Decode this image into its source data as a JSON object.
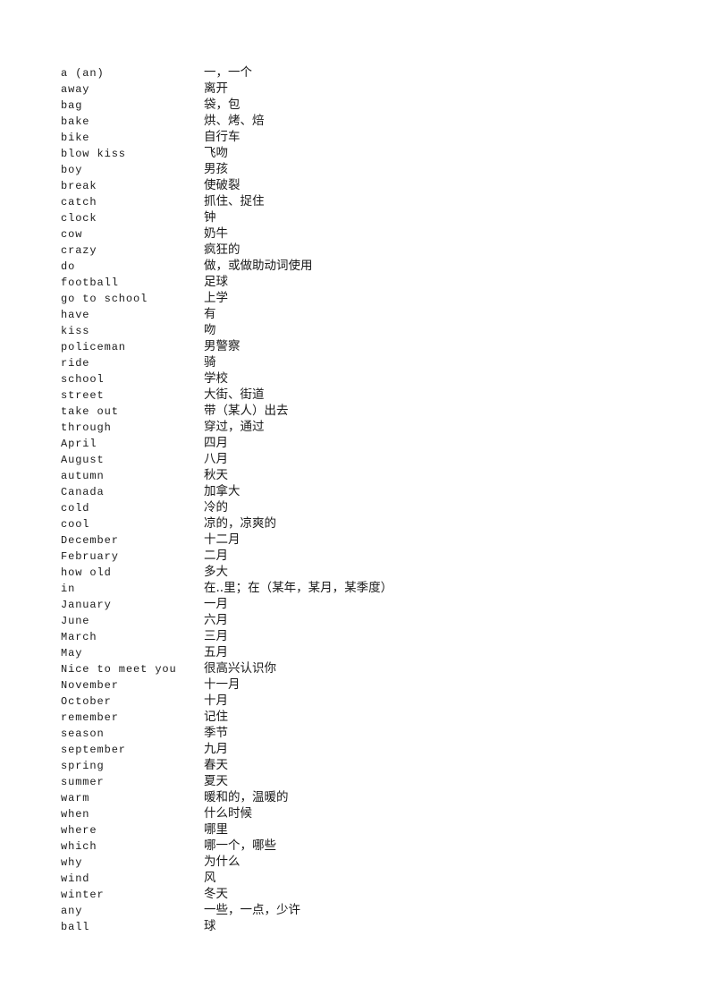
{
  "document": {
    "type": "vocabulary-glossary",
    "columns": {
      "term_header": "",
      "gloss_header": ""
    },
    "entries": [
      {
        "term": "a (an)",
        "gloss": "一，一个"
      },
      {
        "term": "away",
        "gloss": "离开"
      },
      {
        "term": "bag",
        "gloss": "袋，包"
      },
      {
        "term": "bake",
        "gloss": "烘、烤、焙"
      },
      {
        "term": "bike",
        "gloss": "自行车"
      },
      {
        "term": "blow kiss",
        "gloss": "飞吻"
      },
      {
        "term": "boy",
        "gloss": "男孩"
      },
      {
        "term": "break",
        "gloss": "使破裂"
      },
      {
        "term": "catch",
        "gloss": "抓住、捉住"
      },
      {
        "term": "clock",
        "gloss": "钟"
      },
      {
        "term": "cow",
        "gloss": "奶牛"
      },
      {
        "term": "crazy",
        "gloss": "疯狂的"
      },
      {
        "term": "do",
        "gloss": "做，或做助动词使用"
      },
      {
        "term": "football",
        "gloss": "足球"
      },
      {
        "term": "go to school",
        "gloss": "上学"
      },
      {
        "term": "have",
        "gloss": "有"
      },
      {
        "term": "kiss",
        "gloss": "吻"
      },
      {
        "term": "policeman",
        "gloss": "男警察"
      },
      {
        "term": "ride",
        "gloss": "骑"
      },
      {
        "term": "school",
        "gloss": "学校"
      },
      {
        "term": "street",
        "gloss": "大街、街道"
      },
      {
        "term": "take out",
        "gloss": "带（某人）出去"
      },
      {
        "term": "through",
        "gloss": "穿过，通过"
      },
      {
        "term": "April",
        "gloss": "四月"
      },
      {
        "term": "August",
        "gloss": "八月"
      },
      {
        "term": "autumn",
        "gloss": "秋天"
      },
      {
        "term": "Canada",
        "gloss": "加拿大"
      },
      {
        "term": "cold",
        "gloss": "冷的"
      },
      {
        "term": "cool",
        "gloss": "凉的，凉爽的"
      },
      {
        "term": "December",
        "gloss": "十二月"
      },
      {
        "term": "February",
        "gloss": "二月"
      },
      {
        "term": "how old",
        "gloss": "多大"
      },
      {
        "term": "in",
        "gloss": "在..里；在（某年，某月，某季度）"
      },
      {
        "term": "January",
        "gloss": "一月"
      },
      {
        "term": "June",
        "gloss": "六月"
      },
      {
        "term": "March",
        "gloss": "三月"
      },
      {
        "term": "May",
        "gloss": "五月"
      },
      {
        "term": "Nice to meet you",
        "gloss": "很高兴认识你"
      },
      {
        "term": "November",
        "gloss": "十一月"
      },
      {
        "term": "October",
        "gloss": "十月"
      },
      {
        "term": "remember",
        "gloss": "记住"
      },
      {
        "term": "season",
        "gloss": "季节"
      },
      {
        "term": "september",
        "gloss": "九月"
      },
      {
        "term": "spring",
        "gloss": "春天"
      },
      {
        "term": "summer",
        "gloss": "夏天"
      },
      {
        "term": "warm",
        "gloss": "暖和的，温暖的"
      },
      {
        "term": "when",
        "gloss": "什么时候"
      },
      {
        "term": "where",
        "gloss": "哪里"
      },
      {
        "term": "which",
        "gloss": "哪一个，哪些"
      },
      {
        "term": "why",
        "gloss": "为什么"
      },
      {
        "term": "wind",
        "gloss": "风"
      },
      {
        "term": "winter",
        "gloss": "冬天"
      },
      {
        "term": "any",
        "gloss": "一些，一点，少许"
      },
      {
        "term": "ball",
        "gloss": "球"
      }
    ]
  }
}
